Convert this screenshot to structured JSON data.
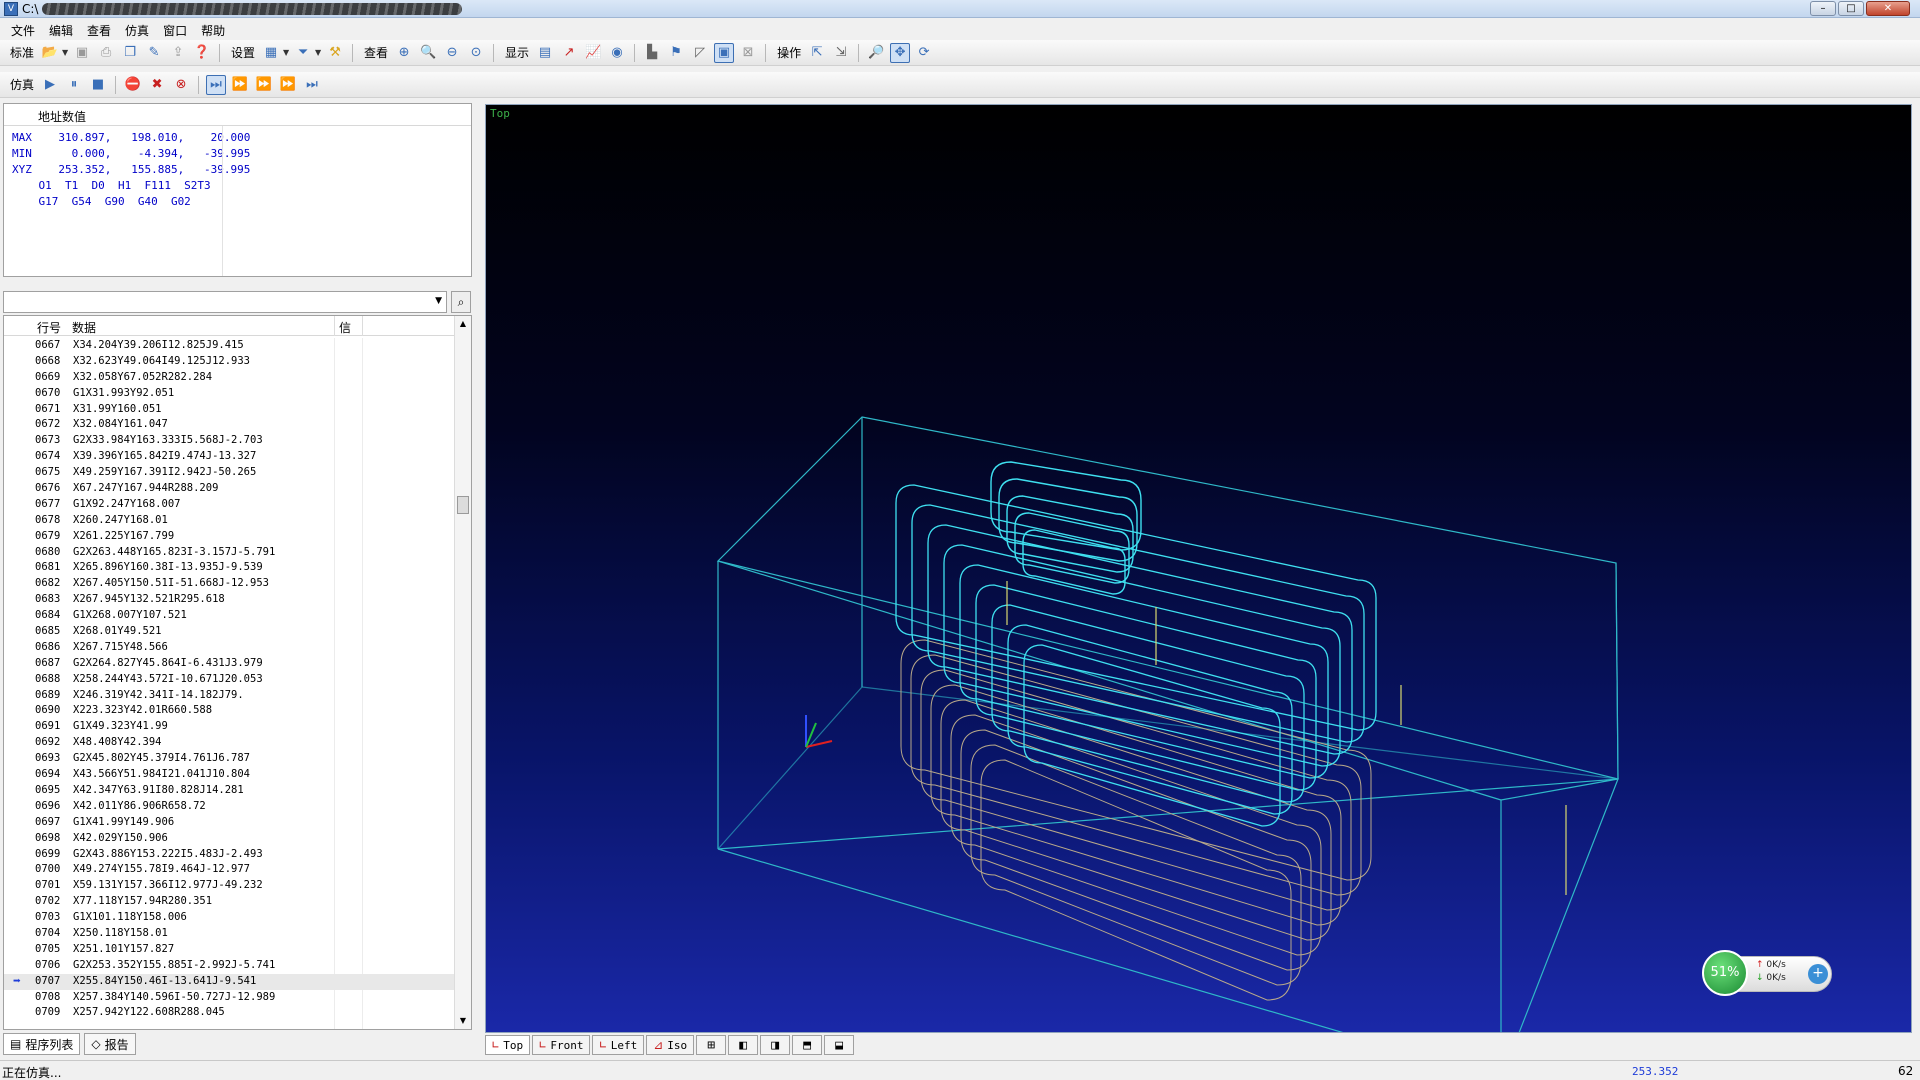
{
  "window": {
    "title": "C:\\"
  },
  "menu": [
    "文件",
    "编辑",
    "查看",
    "仿真",
    "窗口",
    "帮助"
  ],
  "toolbar1": {
    "standard_label": "标准",
    "settings_label": "设置",
    "view_label": "查看",
    "display_label": "显示",
    "operate_label": "操作"
  },
  "toolbar2": {
    "sim_label": "仿真"
  },
  "address_panel": {
    "header": "地址数值",
    "lines": [
      "MAX    310.897,   198.010,    20.000",
      "MIN      0.000,    -4.394,   -39.995",
      "XYZ    253.352,   155.885,   -39.995",
      "    O1  T1  D0  H1  F111  S2T3",
      "    G17  G54  G90  G40  G02"
    ]
  },
  "code_list": {
    "headers": {
      "line": "行号",
      "data": "数据",
      "info": "信"
    },
    "current_line": "0707",
    "rows": [
      [
        "0667",
        "X34.204Y39.206I12.825J9.415"
      ],
      [
        "0668",
        "X32.623Y49.064I49.125J12.933"
      ],
      [
        "0669",
        "X32.058Y67.052R282.284"
      ],
      [
        "0670",
        "G1X31.993Y92.051"
      ],
      [
        "0671",
        "X31.99Y160.051"
      ],
      [
        "0672",
        "X32.084Y161.047"
      ],
      [
        "0673",
        "G2X33.984Y163.333I5.568J-2.703"
      ],
      [
        "0674",
        "X39.396Y165.842I9.474J-13.327"
      ],
      [
        "0675",
        "X49.259Y167.391I2.942J-50.265"
      ],
      [
        "0676",
        "X67.247Y167.944R288.209"
      ],
      [
        "0677",
        "G1X92.247Y168.007"
      ],
      [
        "0678",
        "X260.247Y168.01"
      ],
      [
        "0679",
        "X261.225Y167.799"
      ],
      [
        "0680",
        "G2X263.448Y165.823I-3.157J-5.791"
      ],
      [
        "0681",
        "X265.896Y160.38I-13.935J-9.539"
      ],
      [
        "0682",
        "X267.405Y150.51I-51.668J-12.953"
      ],
      [
        "0683",
        "X267.945Y132.521R295.618"
      ],
      [
        "0684",
        "G1X268.007Y107.521"
      ],
      [
        "0685",
        "X268.01Y49.521"
      ],
      [
        "0686",
        "X267.715Y48.566"
      ],
      [
        "0687",
        "G2X264.827Y45.864I-6.431J3.979"
      ],
      [
        "0688",
        "X258.244Y43.572I-10.671J20.053"
      ],
      [
        "0689",
        "X246.319Y42.341I-14.182J79."
      ],
      [
        "0690",
        "X223.323Y42.01R660.588"
      ],
      [
        "0691",
        "G1X49.323Y41.99"
      ],
      [
        "0692",
        "X48.408Y42.394"
      ],
      [
        "0693",
        "G2X45.802Y45.379I4.761J6.787"
      ],
      [
        "0694",
        "X43.566Y51.984I21.041J10.804"
      ],
      [
        "0695",
        "X42.347Y63.91I80.828J14.281"
      ],
      [
        "0696",
        "X42.011Y86.906R658.72"
      ],
      [
        "0697",
        "G1X41.99Y149.906"
      ],
      [
        "0698",
        "X42.029Y150.906"
      ],
      [
        "0699",
        "G2X43.886Y153.222I5.483J-2.493"
      ],
      [
        "0700",
        "X49.274Y155.78I9.464J-12.977"
      ],
      [
        "0701",
        "X59.131Y157.366I12.977J-49.232"
      ],
      [
        "0702",
        "X77.118Y157.94R280.351"
      ],
      [
        "0703",
        "G1X101.118Y158.006"
      ],
      [
        "0704",
        "X250.118Y158.01"
      ],
      [
        "0705",
        "X251.101Y157.827"
      ],
      [
        "0706",
        "G2X253.352Y155.885I-2.992J-5.741"
      ],
      [
        "0707",
        "X255.84Y150.46I-13.641J-9.541"
      ],
      [
        "0708",
        "X257.384Y140.596I-50.727J-12.989"
      ],
      [
        "0709",
        "X257.942Y122.608R288.045"
      ]
    ]
  },
  "left_tabs": [
    "程序列表",
    "报告"
  ],
  "viewport": {
    "label": "Top"
  },
  "network": {
    "percent": "51%",
    "up": "0K/s",
    "down": "0K/s"
  },
  "view_tabs": [
    "Top",
    "Front",
    "Left",
    "Iso"
  ],
  "status": {
    "message": "正在仿真...",
    "coord": "253.352",
    "num": "62"
  },
  "colors": {
    "toolpath_primary": "#3fe0f0",
    "toolpath_secondary": "#b9a98a",
    "stock_box": "#2fb8c8",
    "viewport_bg_bottom": "#1a28a8"
  }
}
